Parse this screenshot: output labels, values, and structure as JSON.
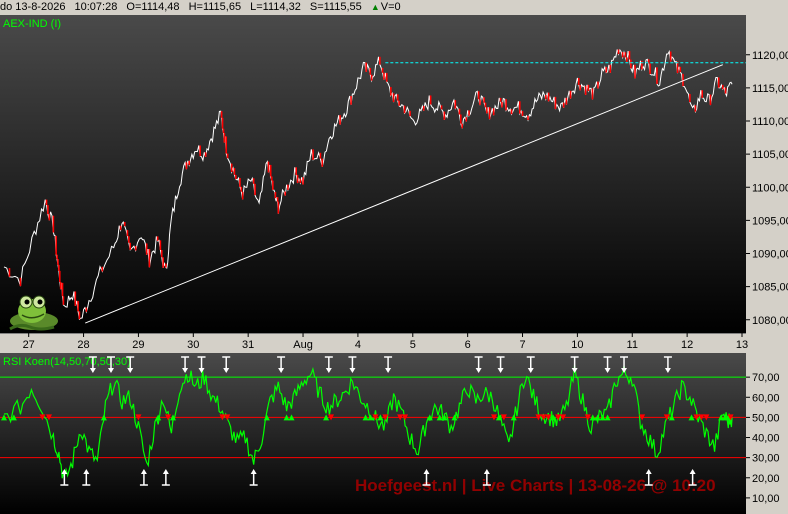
{
  "infobar": {
    "date": "do 13-8-2026",
    "time": "10:07:28",
    "open": "O=1114,48",
    "high": "H=1115,65",
    "low": "L=1114,32",
    "close": "S=1115,55",
    "volume": "V=0"
  },
  "colors": {
    "background": "#000000",
    "price_up": "#ffffff",
    "price_down": "#ff0000",
    "rsi_line": "#00ff00",
    "level_line": "#ff0000",
    "upper_line": "#00ff00",
    "resistance": "#00ffff",
    "trendline": "#ffffff",
    "watermark": "#a00000"
  },
  "chart_data": [
    {
      "type": "line",
      "panel": "price",
      "title": "AEX-IND (I)",
      "x_ticks": [
        "27",
        "28",
        "29",
        "30",
        "31",
        "Aug",
        "4",
        "5",
        "6",
        "7",
        "10",
        "11",
        "12",
        "13"
      ],
      "y_ticks": [
        "1080,00",
        "1085,00",
        "1090,00",
        "1095,00",
        "1100,00",
        "1105,00",
        "1110,00",
        "1115,00",
        "1120,00"
      ],
      "ylim": [
        1078,
        1126
      ],
      "xlim": [
        0,
        13.45
      ],
      "series": [
        {
          "values": [
            [
              0.0,
              1088
            ],
            [
              0.3,
              1086
            ],
            [
              0.55,
              1093
            ],
            [
              0.75,
              1098
            ],
            [
              0.9,
              1094
            ],
            [
              1.0,
              1087
            ],
            [
              1.1,
              1082
            ],
            [
              1.25,
              1084
            ],
            [
              1.4,
              1080
            ],
            [
              1.55,
              1083
            ],
            [
              1.75,
              1087
            ],
            [
              2.0,
              1091
            ],
            [
              2.15,
              1095
            ],
            [
              2.3,
              1090
            ],
            [
              2.5,
              1093
            ],
            [
              2.65,
              1089
            ],
            [
              2.8,
              1092
            ],
            [
              2.95,
              1087
            ],
            [
              3.05,
              1095
            ],
            [
              3.2,
              1101
            ],
            [
              3.35,
              1104
            ],
            [
              3.5,
              1106
            ],
            [
              3.65,
              1105
            ],
            [
              3.8,
              1108
            ],
            [
              3.95,
              1111
            ],
            [
              4.05,
              1106
            ],
            [
              4.2,
              1102
            ],
            [
              4.35,
              1099
            ],
            [
              4.5,
              1101
            ],
            [
              4.65,
              1097
            ],
            [
              4.8,
              1104
            ],
            [
              4.92,
              1099
            ],
            [
              5.0,
              1097
            ],
            [
              5.15,
              1100
            ],
            [
              5.3,
              1102
            ],
            [
              5.45,
              1101
            ],
            [
              5.6,
              1105
            ],
            [
              5.8,
              1104
            ],
            [
              5.95,
              1108
            ],
            [
              6.1,
              1110
            ],
            [
              6.25,
              1112
            ],
            [
              6.4,
              1115
            ],
            [
              6.55,
              1118
            ],
            [
              6.7,
              1117
            ],
            [
              6.85,
              1119
            ],
            [
              7.0,
              1115
            ],
            [
              7.15,
              1113
            ],
            [
              7.3,
              1112
            ],
            [
              7.45,
              1110
            ],
            [
              7.6,
              1111
            ],
            [
              7.75,
              1113
            ],
            [
              7.9,
              1112
            ],
            [
              8.05,
              1111
            ],
            [
              8.2,
              1113
            ],
            [
              8.35,
              1110
            ],
            [
              8.5,
              1112
            ],
            [
              8.65,
              1114
            ],
            [
              8.8,
              1111
            ],
            [
              8.95,
              1112
            ],
            [
              9.1,
              1113
            ],
            [
              9.25,
              1112
            ],
            [
              9.4,
              1112
            ],
            [
              9.55,
              1111
            ],
            [
              9.7,
              1113
            ],
            [
              9.85,
              1114
            ],
            [
              10.0,
              1113
            ],
            [
              10.15,
              1112
            ],
            [
              10.3,
              1114
            ],
            [
              10.45,
              1116
            ],
            [
              10.6,
              1115
            ],
            [
              10.75,
              1114
            ],
            [
              10.9,
              1117
            ],
            [
              11.05,
              1118
            ],
            [
              11.2,
              1121
            ],
            [
              11.35,
              1120
            ],
            [
              11.5,
              1117
            ],
            [
              11.65,
              1119
            ],
            [
              11.8,
              1118
            ],
            [
              11.95,
              1116
            ],
            [
              12.1,
              1121
            ],
            [
              12.25,
              1118
            ],
            [
              12.4,
              1116
            ],
            [
              12.55,
              1111
            ],
            [
              12.7,
              1114
            ],
            [
              12.85,
              1113
            ],
            [
              13.0,
              1116
            ],
            [
              13.15,
              1114
            ],
            [
              13.27,
              1115.55
            ]
          ]
        }
      ],
      "trendline": [
        [
          1.48,
          1079.5
        ],
        [
          13.1,
          1118.5
        ]
      ],
      "resistance": 1118.8,
      "logo": "frog mascot"
    },
    {
      "type": "line",
      "panel": "rsi",
      "title": "RSI Koen(14,50,70,50,30)",
      "y_ticks": [
        "10,00",
        "20,00",
        "30,00",
        "40,00",
        "50,00",
        "60,00",
        "70,00"
      ],
      "ylim": [
        2,
        82
      ],
      "levels": [
        70,
        50,
        30
      ],
      "series": [
        {
          "values": [
            [
              0.0,
              50
            ],
            [
              0.3,
              55
            ],
            [
              0.5,
              65
            ],
            [
              0.7,
              55
            ],
            [
              0.9,
              40
            ],
            [
              1.0,
              32
            ],
            [
              1.1,
              18
            ],
            [
              1.25,
              28
            ],
            [
              1.4,
              45
            ],
            [
              1.55,
              33
            ],
            [
              1.7,
              28
            ],
            [
              1.85,
              55
            ],
            [
              2.0,
              68
            ],
            [
              2.15,
              58
            ],
            [
              2.3,
              60
            ],
            [
              2.45,
              45
            ],
            [
              2.6,
              26
            ],
            [
              2.75,
              45
            ],
            [
              2.9,
              60
            ],
            [
              3.05,
              42
            ],
            [
              3.2,
              65
            ],
            [
              3.35,
              72
            ],
            [
              3.5,
              65
            ],
            [
              3.65,
              70
            ],
            [
              3.8,
              60
            ],
            [
              3.95,
              55
            ],
            [
              4.1,
              45
            ],
            [
              4.25,
              38
            ],
            [
              4.4,
              40
            ],
            [
              4.55,
              28
            ],
            [
              4.7,
              40
            ],
            [
              4.85,
              58
            ],
            [
              5.0,
              65
            ],
            [
              5.15,
              55
            ],
            [
              5.3,
              60
            ],
            [
              5.45,
              68
            ],
            [
              5.6,
              72
            ],
            [
              5.75,
              62
            ],
            [
              5.9,
              55
            ],
            [
              6.05,
              58
            ],
            [
              6.2,
              62
            ],
            [
              6.35,
              68
            ],
            [
              6.5,
              60
            ],
            [
              6.65,
              55
            ],
            [
              6.8,
              48
            ],
            [
              6.95,
              45
            ],
            [
              7.1,
              60
            ],
            [
              7.25,
              52
            ],
            [
              7.4,
              40
            ],
            [
              7.55,
              33
            ],
            [
              7.7,
              48
            ],
            [
              7.85,
              55
            ],
            [
              8.0,
              52
            ],
            [
              8.15,
              45
            ],
            [
              8.3,
              55
            ],
            [
              8.45,
              65
            ],
            [
              8.6,
              58
            ],
            [
              8.75,
              62
            ],
            [
              8.9,
              60
            ],
            [
              9.05,
              48
            ],
            [
              9.2,
              35
            ],
            [
              9.35,
              55
            ],
            [
              9.5,
              72
            ],
            [
              9.65,
              60
            ],
            [
              9.8,
              52
            ],
            [
              9.95,
              50
            ],
            [
              10.1,
              48
            ],
            [
              10.25,
              55
            ],
            [
              10.4,
              72
            ],
            [
              10.55,
              58
            ],
            [
              10.7,
              45
            ],
            [
              10.85,
              50
            ],
            [
              11.0,
              52
            ],
            [
              11.15,
              68
            ],
            [
              11.3,
              72
            ],
            [
              11.45,
              70
            ],
            [
              11.6,
              48
            ],
            [
              11.75,
              40
            ],
            [
              11.9,
              32
            ],
            [
              12.05,
              45
            ],
            [
              12.2,
              55
            ],
            [
              12.35,
              65
            ],
            [
              12.5,
              60
            ],
            [
              12.65,
              50
            ],
            [
              12.8,
              42
            ],
            [
              12.95,
              35
            ],
            [
              13.1,
              52
            ],
            [
              13.2,
              48
            ],
            [
              13.27,
              50
            ]
          ]
        }
      ],
      "markers_down": [
        1.62,
        1.95,
        2.3,
        3.3,
        3.6,
        4.05,
        5.05,
        5.92,
        6.35,
        7.0,
        8.65,
        9.05,
        9.6,
        10.4,
        11.0,
        11.3,
        12.1
      ],
      "markers_up": [
        1.1,
        1.5,
        2.55,
        2.95,
        4.55,
        7.7,
        8.8,
        11.75,
        12.55
      ],
      "watermark": "Hoefgeest.nl | Live Charts | 13-08-26 @ 10:20"
    }
  ]
}
